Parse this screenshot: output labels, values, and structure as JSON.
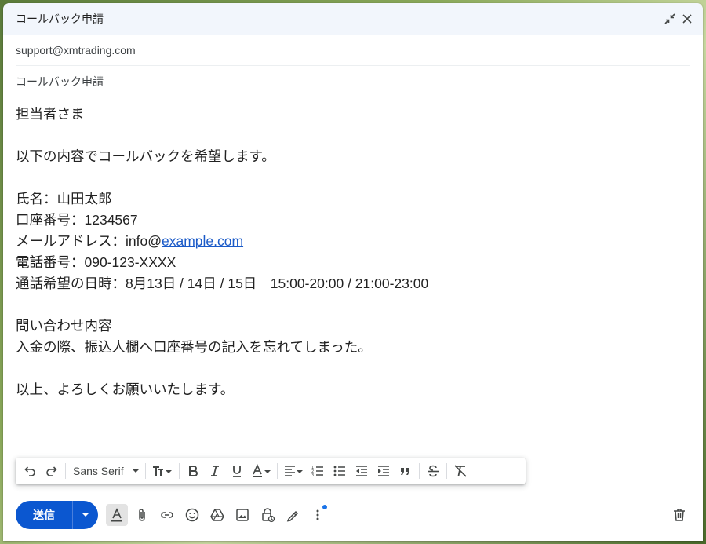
{
  "window": {
    "title": "コールバック申請"
  },
  "compose": {
    "to": "support@xmtrading.com",
    "subject": "コールバック申請",
    "body_lines": [
      "担当者さま",
      "",
      "以下の内容でコールバックを希望します。",
      "",
      "氏名：山田太郎",
      "口座番号：1234567"
    ],
    "email_line_prefix": "メールアドレス：info@",
    "email_line_link": "example.com",
    "body_lines_after": [
      "電話番号：090-123-XXXX",
      "通話希望の日時：8月13日 / 14日 / 15日　15:00-20:00 / 21:00-23:00",
      "",
      "問い合わせ内容",
      "入金の際、振込人欄へ口座番号の記入を忘れてしまった。",
      "",
      "以上、よろしくお願いいたします。"
    ]
  },
  "format_toolbar": {
    "font_name": "Sans Serif"
  },
  "bottom_bar": {
    "send_label": "送信"
  },
  "colors": {
    "accent": "#0b57d0",
    "link": "#1a5ac8",
    "dot": "#1a73e8"
  }
}
